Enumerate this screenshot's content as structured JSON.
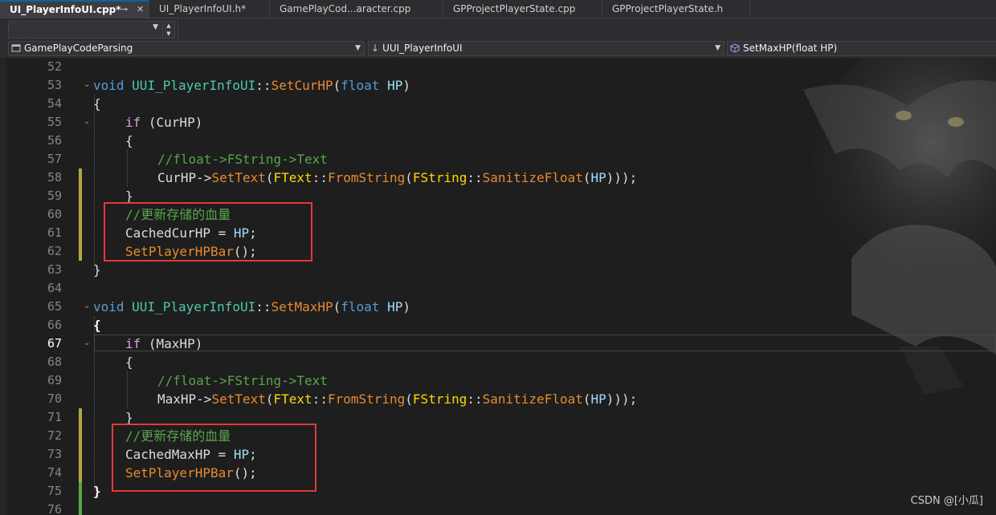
{
  "tabs": [
    {
      "label": "UI_PlayerInfoUI.cpp*",
      "active": true,
      "pin_icon": "pin-icon",
      "close_icon": "close-icon"
    },
    {
      "label": "UI_PlayerInfoUI.h*",
      "active": false
    },
    {
      "label": "GamePlayCod...aracter.cpp",
      "active": false
    },
    {
      "label": "GPProjectPlayerState.cpp",
      "active": false
    },
    {
      "label": "GPProjectPlayerState.h",
      "active": false
    }
  ],
  "navbar": {
    "project": "GamePlayCodeParsing",
    "scope": "UUI_PlayerInfoUI",
    "member": "SetMaxHP(float HP)"
  },
  "editor": {
    "current_line": "67",
    "lines": [
      {
        "num": "52",
        "code": ""
      },
      {
        "num": "53",
        "code": "void UUI_PlayerInfoUI::SetCurHP(float HP)"
      },
      {
        "num": "54",
        "code": "{"
      },
      {
        "num": "55",
        "code": "if (CurHP)"
      },
      {
        "num": "56",
        "code": "{"
      },
      {
        "num": "57",
        "code": "//float->FString->Text"
      },
      {
        "num": "58",
        "code": "CurHP->SetText(FText::FromString(FString::SanitizeFloat(HP)));"
      },
      {
        "num": "59",
        "code": "}"
      },
      {
        "num": "60",
        "code": "//更新存储的血量"
      },
      {
        "num": "61",
        "code": "CachedCurHP = HP;"
      },
      {
        "num": "62",
        "code": "SetPlayerHPBar();"
      },
      {
        "num": "63",
        "code": "}"
      },
      {
        "num": "64",
        "code": ""
      },
      {
        "num": "65",
        "code": "void UUI_PlayerInfoUI::SetMaxHP(float HP)"
      },
      {
        "num": "66",
        "code": "{"
      },
      {
        "num": "67",
        "code": "if (MaxHP)"
      },
      {
        "num": "68",
        "code": "{"
      },
      {
        "num": "69",
        "code": "//float->FString->Text"
      },
      {
        "num": "70",
        "code": "MaxHP->SetText(FText::FromString(FString::SanitizeFloat(HP)));"
      },
      {
        "num": "71",
        "code": "}"
      },
      {
        "num": "72",
        "code": "//更新存储的血量"
      },
      {
        "num": "73",
        "code": "CachedMaxHP = HP;"
      },
      {
        "num": "74",
        "code": "SetPlayerHPBar();"
      },
      {
        "num": "75",
        "code": "}"
      },
      {
        "num": "76",
        "code": ""
      }
    ]
  },
  "watermark": "CSDN @[小瓜]",
  "colors": {
    "keyword": "#569cd6",
    "control": "#d8a0df",
    "class": "#4ec9b0",
    "function": "#dcdcaa",
    "comment": "#57a64a",
    "annotation_box": "#e03a3a",
    "change_bar_modified": "#b5a642",
    "change_bar_saved": "#57a64a"
  }
}
